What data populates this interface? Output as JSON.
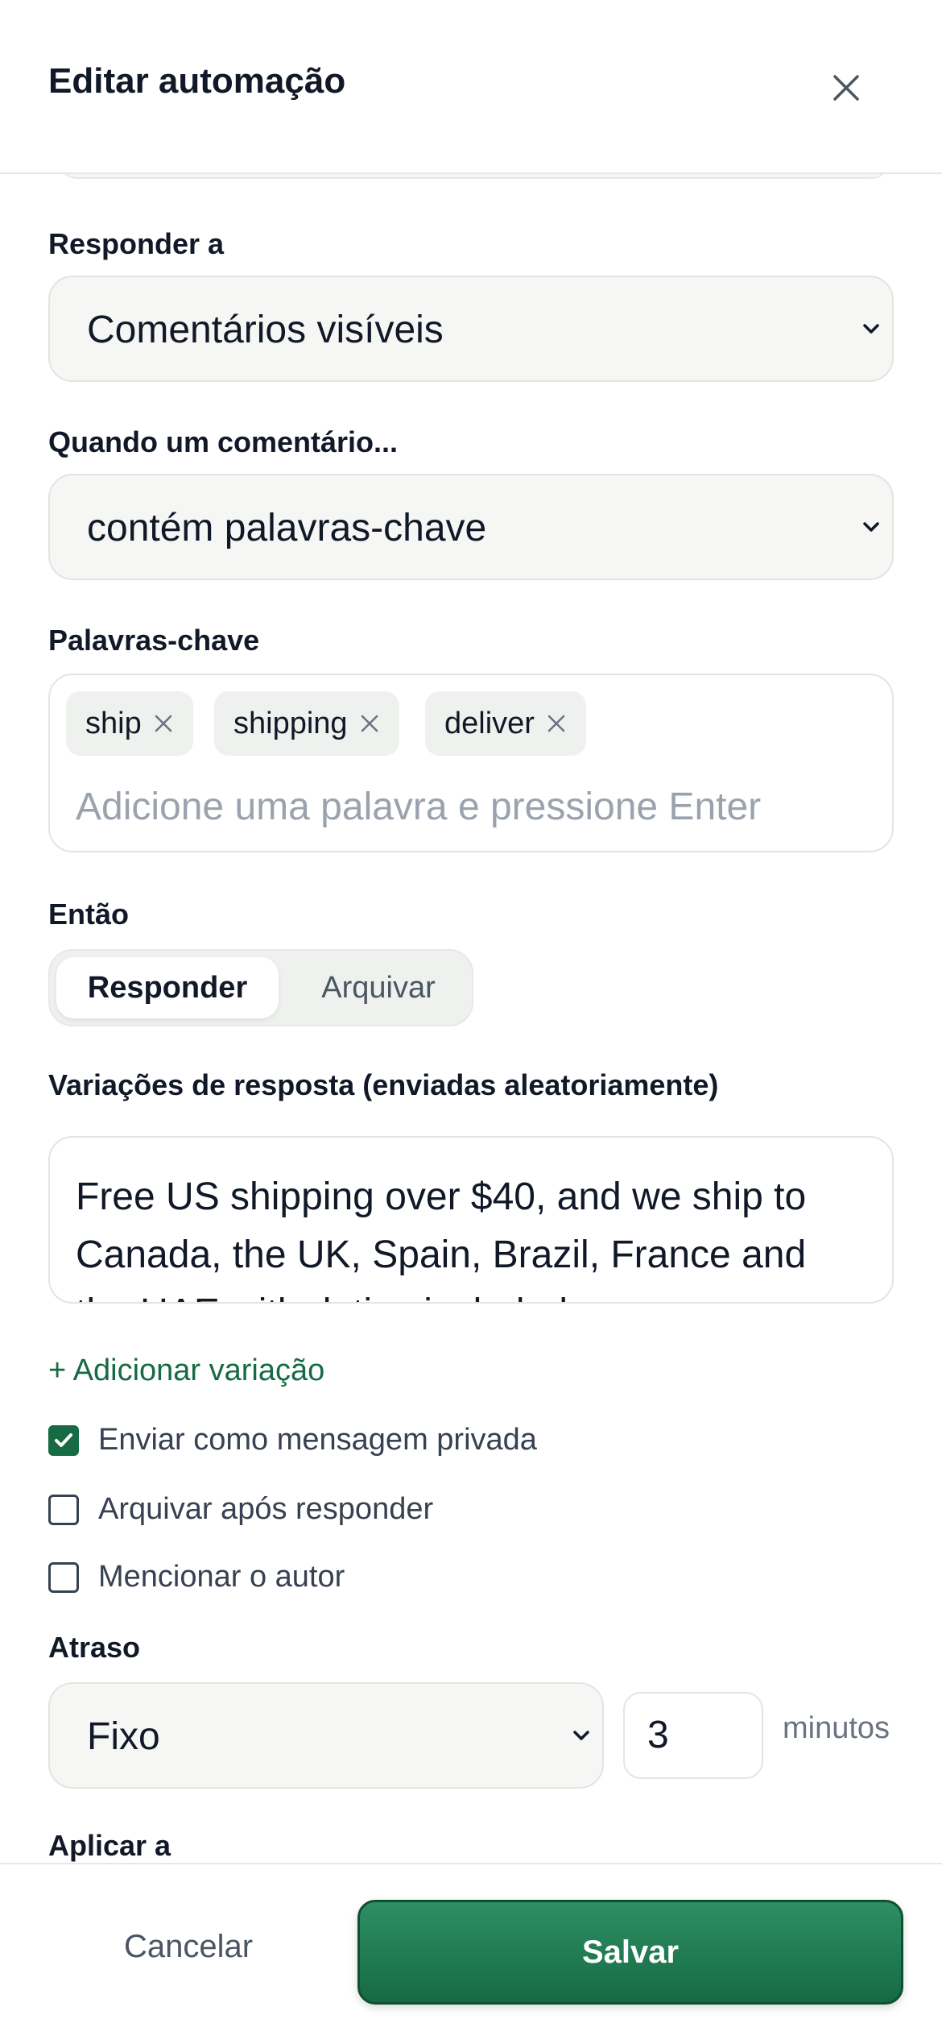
{
  "header": {
    "title": "Editar automação"
  },
  "form": {
    "respond_to": {
      "label": "Responder a",
      "value": "Comentários visíveis"
    },
    "when": {
      "label": "Quando um comentário...",
      "value": "contém palavras-chave"
    },
    "keywords": {
      "label": "Palavras-chave",
      "tags": [
        "ship",
        "shipping",
        "deliver"
      ],
      "placeholder": "Adicione uma palavra e pressione Enter"
    },
    "then": {
      "label": "Então",
      "options": [
        "Responder",
        "Arquivar"
      ],
      "selected": "Responder"
    },
    "variations": {
      "label": "Variações de resposta (enviadas aleatoriamente)",
      "text": "Free US shipping over $40, and we ship to Canada, the UK, Spain, Brazil, France and the UAE with duties included.",
      "add_label": "+ Adicionar variação"
    },
    "checkboxes": [
      {
        "label": "Enviar como mensagem privada",
        "checked": true
      },
      {
        "label": "Arquivar após responder",
        "checked": false
      },
      {
        "label": "Mencionar o autor",
        "checked": false
      }
    ],
    "delay": {
      "label": "Atraso",
      "mode": "Fixo",
      "amount": "3",
      "unit": "minutos"
    },
    "apply_to": {
      "label": "Aplicar a"
    }
  },
  "footer": {
    "cancel_label": "Cancelar",
    "save_label": "Salvar"
  },
  "colors": {
    "accent": "#166a44",
    "field_bg": "#f6f7f5",
    "border": "#e2e5e2"
  }
}
